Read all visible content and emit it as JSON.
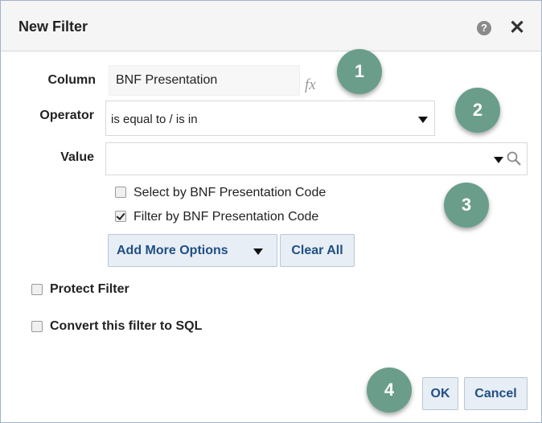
{
  "dialog": {
    "title": "New Filter",
    "help_icon": "help-icon",
    "close_icon": "close-icon",
    "help_glyph": "?",
    "close_glyph": "✕"
  },
  "form": {
    "column_label": "Column",
    "column_value": "BNF Presentation",
    "fx_label": "fx",
    "operator_label": "Operator",
    "operator_value": "is equal to / is in",
    "value_label": "Value",
    "value_value": "",
    "options": [
      {
        "label": "Select by BNF Presentation Code",
        "checked": false
      },
      {
        "label": "Filter by BNF Presentation Code",
        "checked": true
      }
    ],
    "add_more_options_label": "Add More Options",
    "clear_all_label": "Clear All",
    "protect_filter_label": "Protect Filter",
    "protect_filter_checked": false,
    "convert_sql_label": "Convert this filter to SQL",
    "convert_sql_checked": false
  },
  "footer": {
    "ok_label": "OK",
    "cancel_label": "Cancel"
  },
  "callouts": {
    "badges": [
      "1",
      "2",
      "3",
      "4"
    ],
    "color": "#6a9e8a"
  },
  "colors": {
    "button_text": "#1f4f85",
    "button_bg": "#e8eef5",
    "titlebar_bg": "#f5f5f5"
  }
}
